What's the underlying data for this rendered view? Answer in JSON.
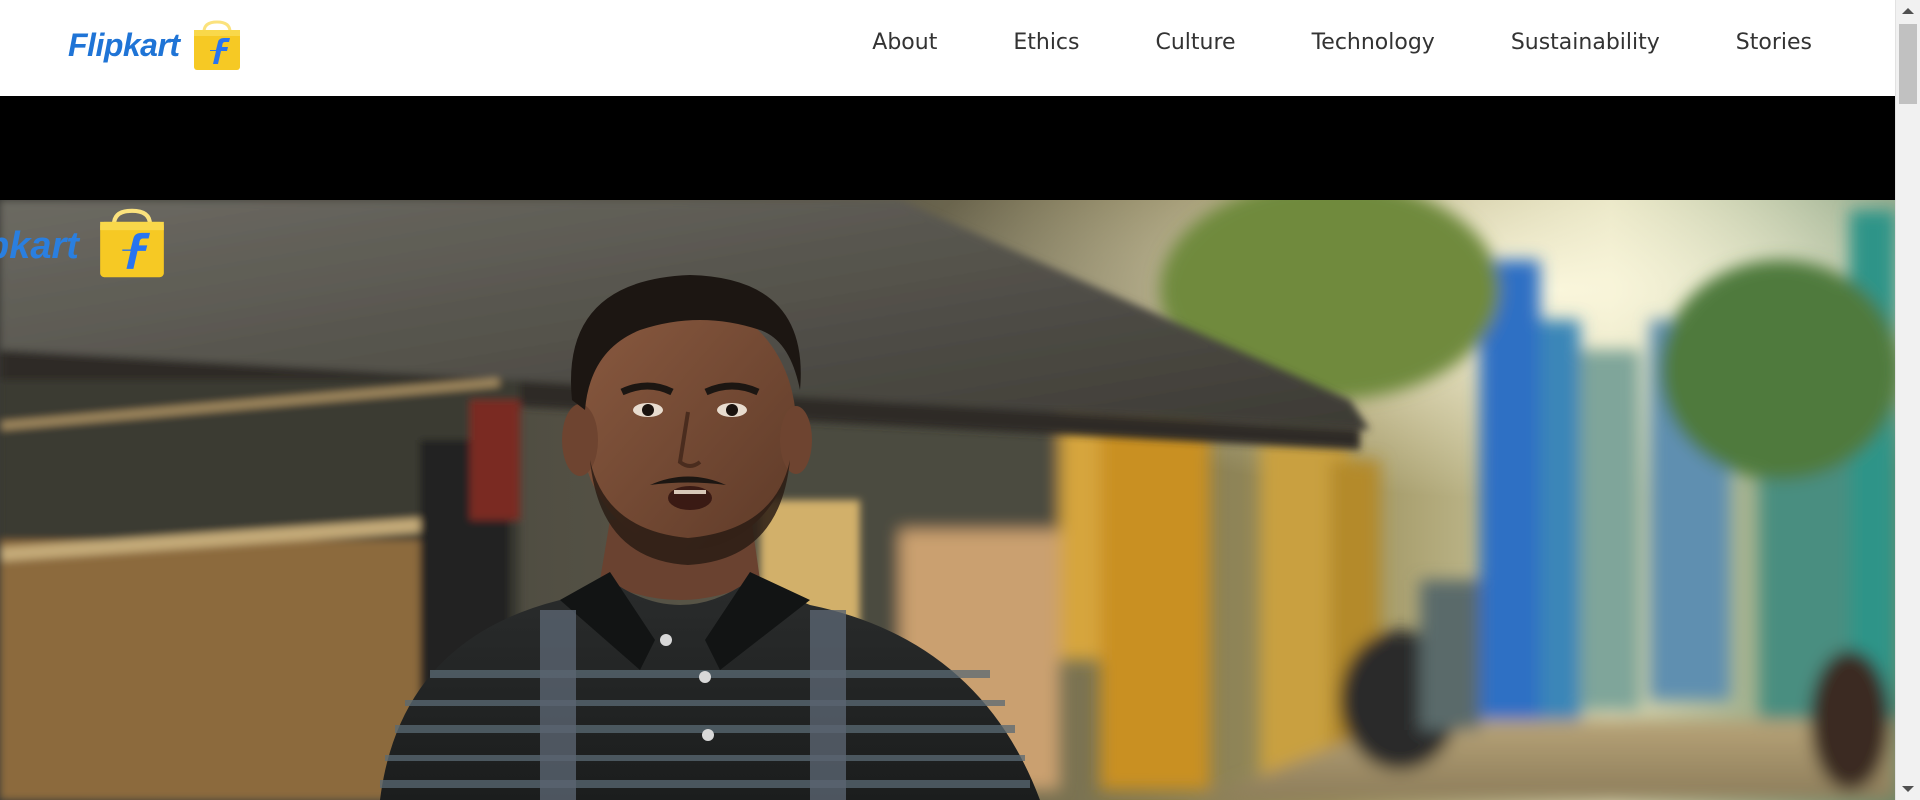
{
  "header": {
    "logo_text": "Flipkart",
    "logo_icon": "flipkart-bag-icon",
    "nav": [
      {
        "label": "About"
      },
      {
        "label": "Ethics"
      },
      {
        "label": "Culture"
      },
      {
        "label": "Technology"
      },
      {
        "label": "Sustainability"
      },
      {
        "label": "Stories"
      }
    ]
  },
  "hero": {
    "overlay_logo_text": "pkart",
    "overlay_logo_icon": "flipkart-bag-icon",
    "image_subject": "video-frame-man-in-village-street"
  },
  "colors": {
    "brand_blue": "#1f74d6",
    "brand_yellow": "#f6c924",
    "header_bg": "#ffffff",
    "nav_text": "#333333",
    "video_bg": "#000000"
  }
}
